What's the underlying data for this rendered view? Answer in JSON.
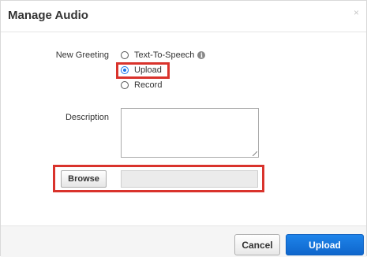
{
  "dialog": {
    "title": "Manage Audio",
    "close_label": "×"
  },
  "form": {
    "greeting_label": "New Greeting",
    "options": [
      {
        "label": "Text-To-Speech",
        "selected": false,
        "icon": "info-icon"
      },
      {
        "label": "Upload",
        "selected": true
      },
      {
        "label": "Record",
        "selected": false
      }
    ],
    "info_icon_glyph": "i",
    "description_label": "Description",
    "description_value": "",
    "browse_label": "Browse",
    "file_value": ""
  },
  "footer": {
    "cancel_label": "Cancel",
    "upload_label": "Upload"
  },
  "colors": {
    "primary": "#1a73e8",
    "highlight": "#d9332c"
  }
}
